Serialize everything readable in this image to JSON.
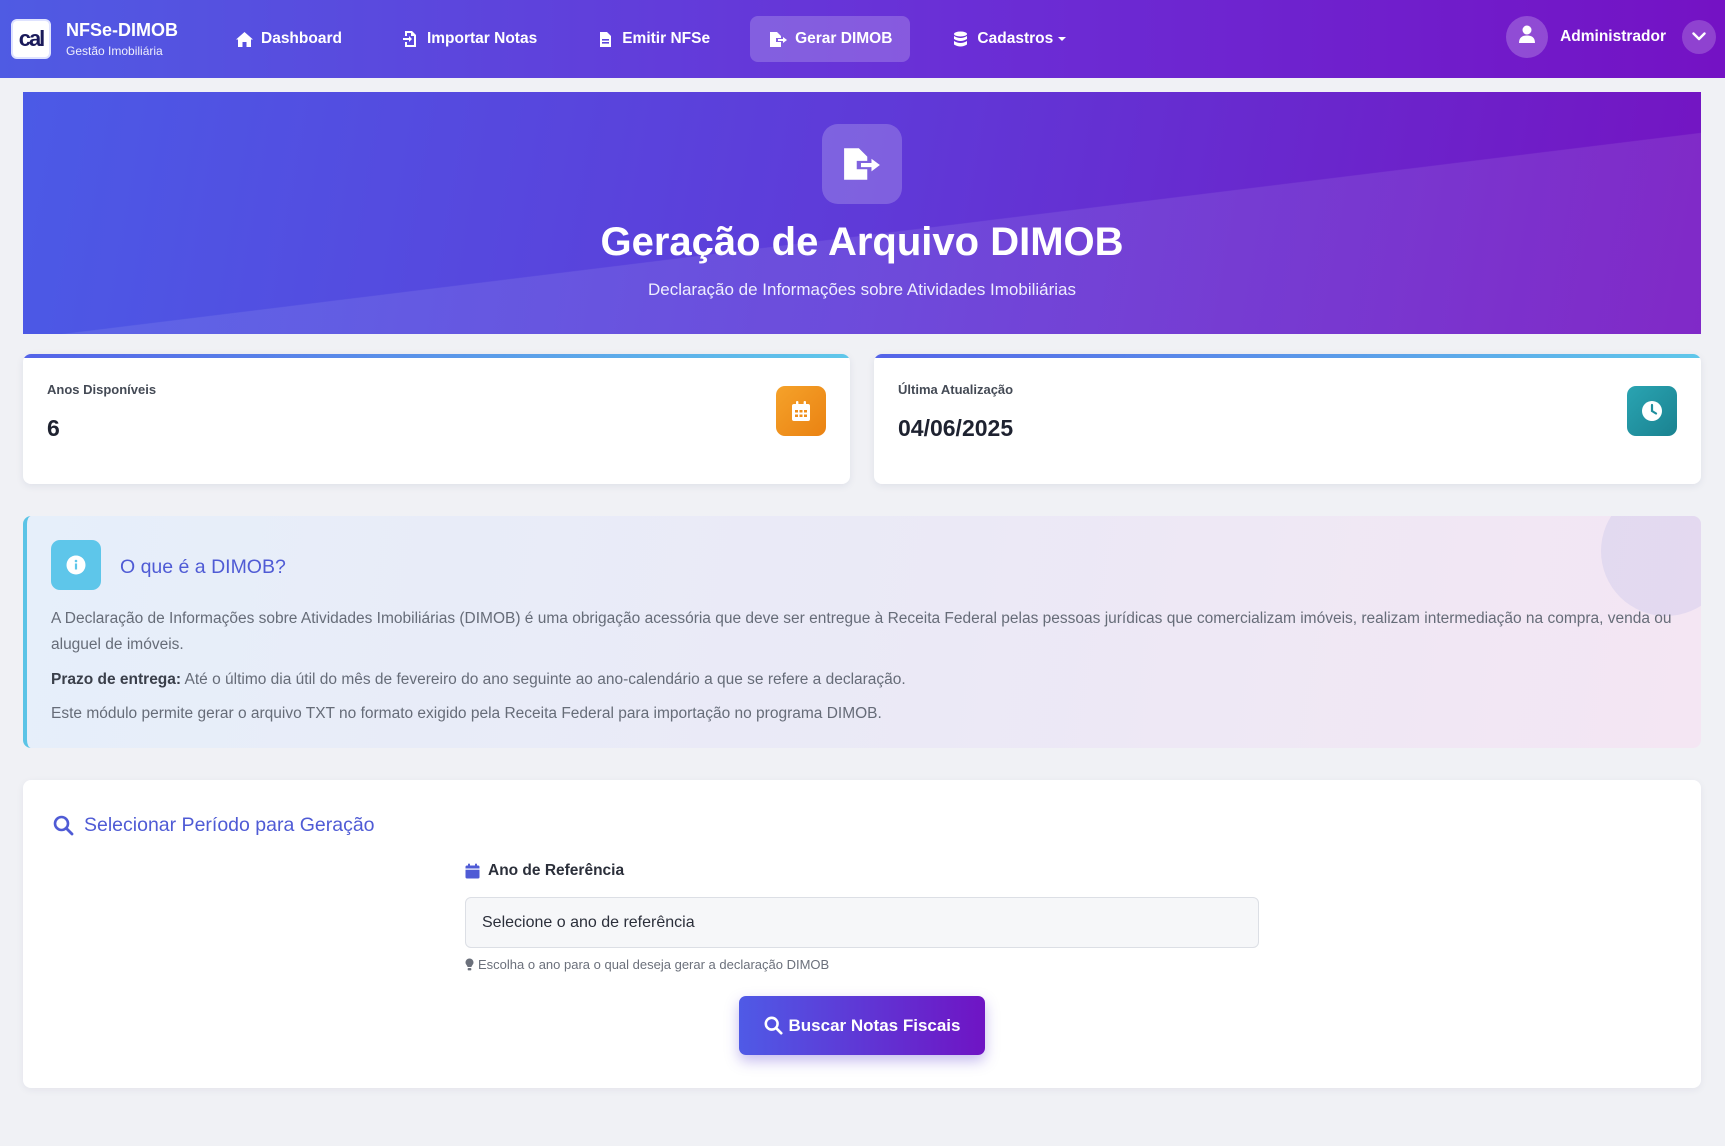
{
  "brand": {
    "logo_text": "cal",
    "title": "NFSe-DIMOB",
    "subtitle": "Gestão Imobiliária"
  },
  "nav": {
    "items": [
      {
        "label": "Dashboard",
        "icon": "home-icon"
      },
      {
        "label": "Importar Notas",
        "icon": "file-import-icon"
      },
      {
        "label": "Emitir NFSe",
        "icon": "file-text-icon"
      },
      {
        "label": "Gerar DIMOB",
        "icon": "file-export-icon",
        "active": true
      },
      {
        "label": "Cadastros",
        "icon": "database-icon",
        "dropdown": true
      }
    ]
  },
  "user": {
    "name": "Administrador",
    "icon": "user-icon"
  },
  "hero": {
    "icon": "file-export-icon",
    "title": "Geração de Arquivo DIMOB",
    "subtitle": "Declaração de Informações sobre Atividades Imobiliárias"
  },
  "stats": [
    {
      "label": "Anos Disponíveis",
      "value": "6",
      "icon": "calendar-icon",
      "color": "#f0941e"
    },
    {
      "label": "Última Atualização",
      "value": "04/06/2025",
      "icon": "clock-icon",
      "color": "#1f8f9d"
    }
  ],
  "info": {
    "title": "O que é a DIMOB?",
    "icon": "info-icon",
    "paragraph1": "A Declaração de Informações sobre Atividades Imobiliárias (DIMOB) é uma obrigação acessória que deve ser entregue à Receita Federal pelas pessoas jurídicas que comercializam imóveis, realizam intermediação na compra, venda ou aluguel de imóveis.",
    "deadline_label": "Prazo de entrega:",
    "deadline_text": " Até o último dia útil do mês de fevereiro do ano seguinte ao ano-calendário a que se refere a declaração.",
    "paragraph3": "Este módulo permite gerar o arquivo TXT no formato exigido pela Receita Federal para importação no programa DIMOB."
  },
  "selection": {
    "title": "Selecionar Período para Geração",
    "field_label": "Ano de Referência",
    "select_value": "Selecione o ano de referência",
    "help_text": "Escolha o ano para o qual deseja gerar a declaração DIMOB",
    "button_label": "Buscar Notas Fiscais"
  },
  "colors": {
    "accent": "#4f5bd5",
    "nav_gradient_start": "#4f5be3",
    "nav_gradient_end": "#7412c4",
    "info_border": "#5bc4e6"
  }
}
